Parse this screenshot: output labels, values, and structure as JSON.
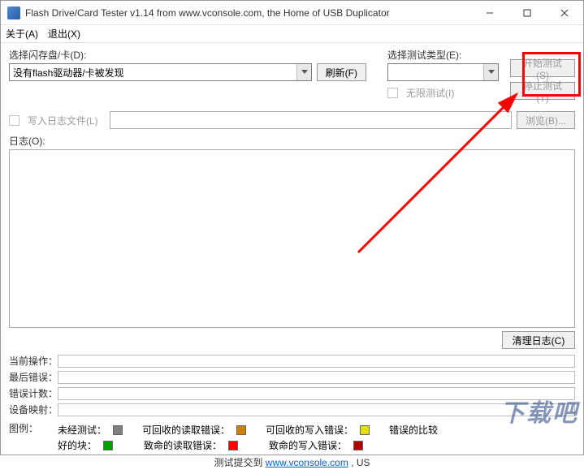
{
  "title": "Flash Drive/Card Tester v1.14 from www.vconsole.com, the Home of USB Duplicator",
  "menu": {
    "about": "关于(A)",
    "exit": "退出(X)"
  },
  "disk": {
    "label": "选择闪存盘/卡(D):",
    "value": "没有flash驱动器/卡被发现",
    "refresh": "刷新(F)"
  },
  "test": {
    "label": "选择测试类型(E):",
    "infinite": "无限测试(I)",
    "start": "开始测试(S)",
    "stop": "停止测试(T)"
  },
  "logfile": {
    "checkbox": "写入日志文件(L)",
    "browse": "浏览(B)..."
  },
  "log": {
    "label": "日志(O):",
    "clear": "清理日志(C)"
  },
  "status": {
    "current": "当前操作：",
    "lasterr": "最后错误：",
    "errcount": "错误计数：",
    "devmap": "设备映射："
  },
  "legend": {
    "title": "图例：",
    "row1": {
      "untested": "未经测试：",
      "rread": "可回收的读取错误：",
      "rwrite": "可回收的写入错误：",
      "compare": "错误的比较"
    },
    "row2": {
      "good": "好的块：",
      "fread": "致命的读取错误：",
      "fwrite": "致命的写入错误："
    }
  },
  "footer": {
    "prefix": "测试提交到 ",
    "link": "www.vconsole.com",
    "suffix": " , US"
  },
  "colors": {
    "untested": "#808080",
    "good": "#00a000",
    "rread": "#d08000",
    "fread": "#ff0000",
    "rwrite": "#e0e000",
    "fwrite": "#b00000"
  },
  "watermark": "下载吧"
}
